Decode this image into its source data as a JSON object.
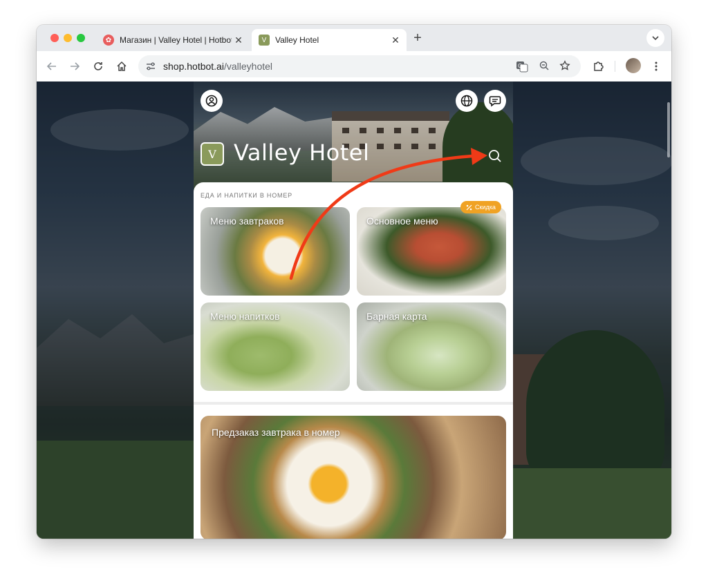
{
  "browser": {
    "tabs": [
      {
        "title": "Магазин | Valley Hotel | Hotbot",
        "active": false
      },
      {
        "title": "Valley Hotel",
        "active": true
      }
    ],
    "new_tab_icon": "plus-icon",
    "address": {
      "host": "shop.hotbot.ai",
      "path": "/valleyhotel"
    }
  },
  "app": {
    "brand_name": "Valley Hotel",
    "logo_glyph": "V",
    "section_title": "ЕДА И НАПИТКИ В НОМЕР",
    "cards": [
      {
        "label": "Меню завтраков"
      },
      {
        "label": "Основное меню",
        "badge": "Скидка"
      },
      {
        "label": "Меню напитков"
      },
      {
        "label": "Барная карта"
      }
    ],
    "promo": {
      "label": "Предзаказ завтрака в номер"
    }
  },
  "colors": {
    "accent": "#8a9a5b",
    "badge": "#f0a224",
    "annotation_arrow": "#f03a17"
  }
}
